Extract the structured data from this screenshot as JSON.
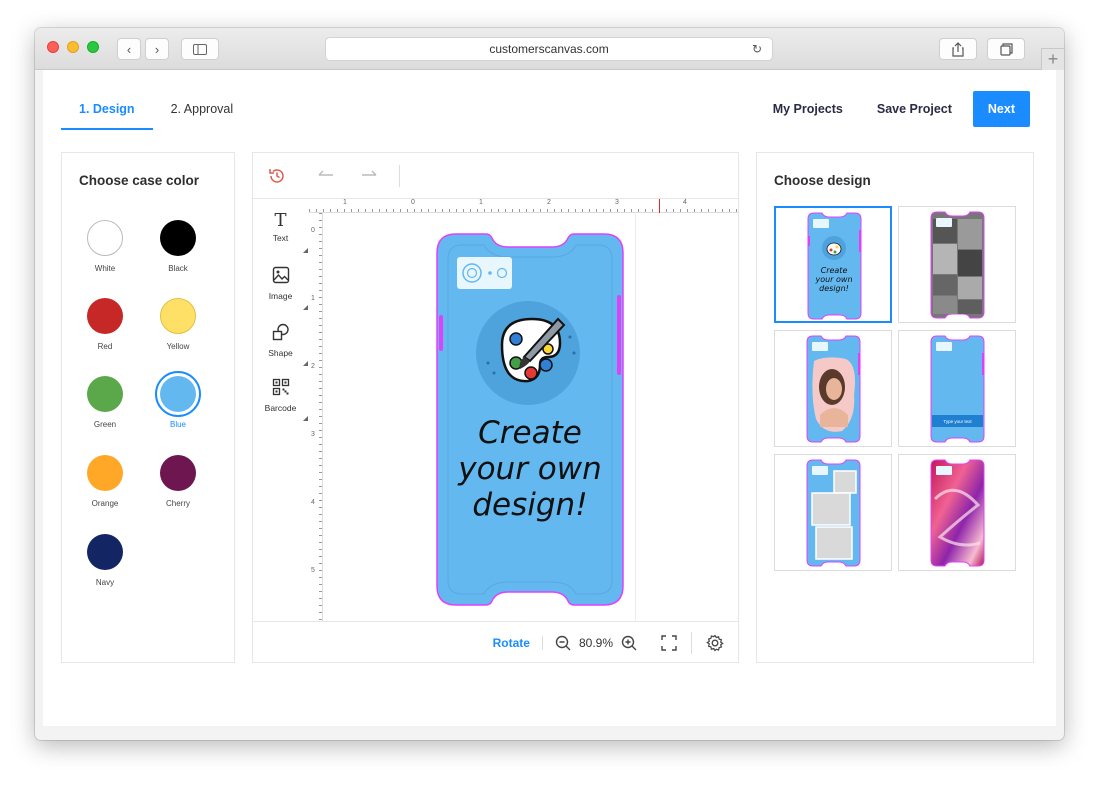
{
  "browser": {
    "url": "customerscanvas.com"
  },
  "tabs": [
    {
      "label": "1. Design",
      "active": true
    },
    {
      "label": "2. Approval",
      "active": false
    }
  ],
  "header": {
    "my_projects": "My Projects",
    "save_project": "Save Project",
    "next": "Next"
  },
  "colors_panel": {
    "title": "Choose case color",
    "selected": "Blue",
    "swatches": [
      {
        "label": "White",
        "color": "#ffffff"
      },
      {
        "label": "Black",
        "color": "#000000"
      },
      {
        "label": "Red",
        "color": "#c62828"
      },
      {
        "label": "Yellow",
        "color": "#ffe066"
      },
      {
        "label": "Green",
        "color": "#5aa84a"
      },
      {
        "label": "Blue",
        "color": "#64b8f0"
      },
      {
        "label": "Orange",
        "color": "#ffa726"
      },
      {
        "label": "Cherry",
        "color": "#6d1650"
      },
      {
        "label": "Navy",
        "color": "#132563"
      }
    ]
  },
  "editor": {
    "tools": [
      {
        "label": "Text",
        "icon": "text-icon"
      },
      {
        "label": "Image",
        "icon": "image-icon"
      },
      {
        "label": "Shape",
        "icon": "shape-icon"
      },
      {
        "label": "Barcode",
        "icon": "barcode-icon"
      }
    ],
    "ruler_h": [
      "1",
      "0",
      "1",
      "2",
      "3",
      "4"
    ],
    "ruler_v": [
      "0",
      "1",
      "2",
      "3",
      "4",
      "5"
    ],
    "canvas_text": [
      "Create",
      "your own",
      "design!"
    ],
    "case_color": "#64b8f0",
    "outline_color": "#e040fb",
    "rotate_label": "Rotate",
    "zoom": "80.9%"
  },
  "designs_panel": {
    "title": "Choose design",
    "thumb_text": [
      "Create",
      "your own",
      "design!"
    ],
    "banner_text": "Type your text"
  }
}
